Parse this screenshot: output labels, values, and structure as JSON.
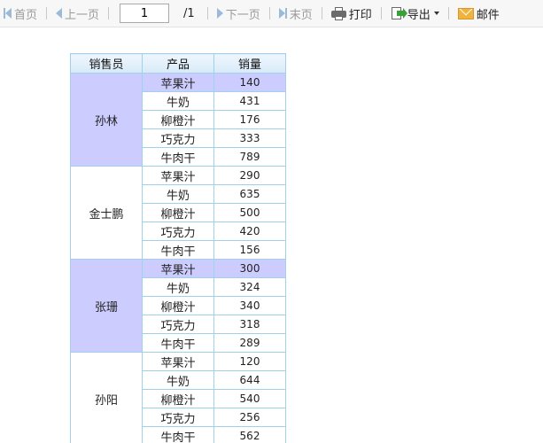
{
  "toolbar": {
    "first_label": "首页",
    "prev_label": "上一页",
    "page_value": "1",
    "page_total": "/1",
    "next_label": "下一页",
    "last_label": "末页",
    "print_label": "打印",
    "export_label": "导出",
    "mail_label": "邮件"
  },
  "table": {
    "headers": [
      "销售员",
      "产品",
      "销量"
    ],
    "groups": [
      {
        "salesperson": "孙林",
        "highlight": true,
        "rows": [
          {
            "product": "苹果汁",
            "qty": "140"
          },
          {
            "product": "牛奶",
            "qty": "431"
          },
          {
            "product": "柳橙汁",
            "qty": "176"
          },
          {
            "product": "巧克力",
            "qty": "333"
          },
          {
            "product": "牛肉干",
            "qty": "789"
          }
        ]
      },
      {
        "salesperson": "金士鹏",
        "highlight": false,
        "rows": [
          {
            "product": "苹果汁",
            "qty": "290"
          },
          {
            "product": "牛奶",
            "qty": "635"
          },
          {
            "product": "柳橙汁",
            "qty": "500"
          },
          {
            "product": "巧克力",
            "qty": "420"
          },
          {
            "product": "牛肉干",
            "qty": "156"
          }
        ]
      },
      {
        "salesperson": "张珊",
        "highlight": true,
        "rows": [
          {
            "product": "苹果汁",
            "qty": "300"
          },
          {
            "product": "牛奶",
            "qty": "324"
          },
          {
            "product": "柳橙汁",
            "qty": "340"
          },
          {
            "product": "巧克力",
            "qty": "318"
          },
          {
            "product": "牛肉干",
            "qty": "289"
          }
        ]
      },
      {
        "salesperson": "孙阳",
        "highlight": false,
        "rows": [
          {
            "product": "苹果汁",
            "qty": "120"
          },
          {
            "product": "牛奶",
            "qty": "644"
          },
          {
            "product": "柳橙汁",
            "qty": "540"
          },
          {
            "product": "巧克力",
            "qty": "256"
          },
          {
            "product": "牛肉干",
            "qty": "562"
          }
        ]
      }
    ]
  }
}
